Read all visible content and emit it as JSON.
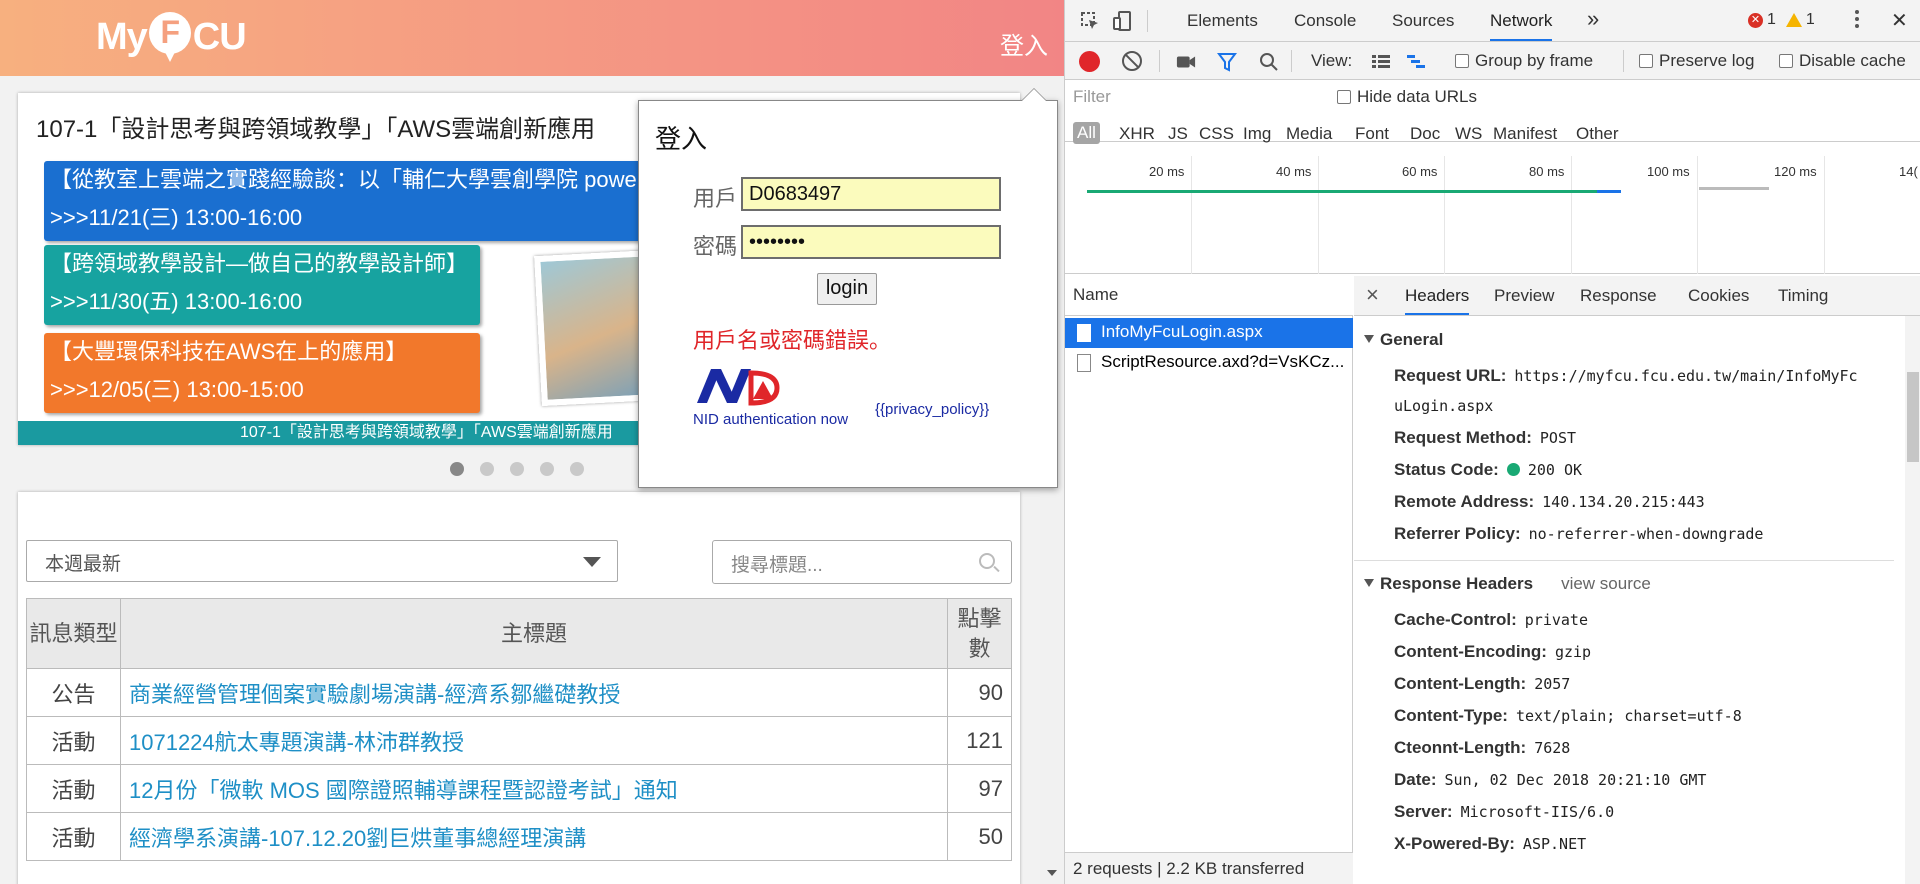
{
  "site": {
    "logo_text_left": "My",
    "logo_letter": "F",
    "logo_text_right": "CU",
    "login_link": "登入"
  },
  "banner": {
    "title": "107-1「設計思考與跨領域教學」「AWS雲端創新應用",
    "events": [
      {
        "line1": "【從教室上雲端之實踐經驗談：以「輔仁大學雲創學院 powe",
        "line2": ">>>11/21(三) 13:00-16:00",
        "color": "#1a6fd0"
      },
      {
        "line1": "【跨領域教學設計—做自己的教學設計師】",
        "line2": ">>>11/30(五) 13:00-16:00",
        "color": "#17a3a0"
      },
      {
        "line1": "【大豐環保科技在AWS在上的應用】",
        "line2": ">>>12/05(三) 13:00-15:00",
        "color": "#f2782b"
      }
    ],
    "strip_text": "107-1「設計思考與跨領域教學」「AWS雲端創新應用",
    "slide_count": 5,
    "active_slide": 1
  },
  "news": {
    "filter_value": "本週最新",
    "search_placeholder": "搜尋標題...",
    "headers": {
      "type": "訊息類型",
      "title": "主標題",
      "hits": "點擊數"
    },
    "rows": [
      {
        "type": "公告",
        "title": "商業經營管理個案實驗劇場演講-經濟系鄒繼礎教授",
        "hits": "90"
      },
      {
        "type": "活動",
        "title": "1071224航太專題演講-林沛群教授",
        "hits": "121"
      },
      {
        "type": "活動",
        "title": "12月份「微軟 MOS 國際證照輔導課程暨認證考試」通知",
        "hits": "97"
      },
      {
        "type": "活動",
        "title": "經濟學系演講-107.12.20劉巨烘董事總經理演講",
        "hits": "50"
      }
    ]
  },
  "login": {
    "heading": "登入",
    "user_label": "用戶",
    "user_value": "D0683497",
    "pass_label": "密碼",
    "pass_value": "••••••••",
    "button": "login",
    "error": "用戶名或密碼錯誤。",
    "nid_caption": "NID authentication now",
    "privacy_link": "{{privacy_policy}}"
  },
  "devtools": {
    "tabs": [
      "Elements",
      "Console",
      "Sources",
      "Network"
    ],
    "active_tab": "Network",
    "more": "»",
    "error_count": "1",
    "warning_count": "1",
    "close": "✕",
    "toolbar": {
      "view_label": "View:",
      "group_by_frame": "Group by frame",
      "preserve_log": "Preserve log",
      "disable_cache": "Disable cache"
    },
    "filter_placeholder": "Filter",
    "hide_data_urls": "Hide data URLs",
    "type_filters": [
      "All",
      "XHR",
      "JS",
      "CSS",
      "Img",
      "Media",
      "Font",
      "Doc",
      "WS",
      "Manifest",
      "Other"
    ],
    "timeline_ticks": [
      "20 ms",
      "40 ms",
      "60 ms",
      "80 ms",
      "100 ms",
      "120 ms",
      "14("
    ],
    "list_header": "Name",
    "requests": [
      "InfoMyFcuLogin.aspx",
      "ScriptResource.axd?d=VsKCz..."
    ],
    "status_bar": "2 requests  |  2.2 KB transferred",
    "detail_tabs": [
      "Headers",
      "Preview",
      "Response",
      "Cookies",
      "Timing"
    ],
    "general": {
      "title": "General",
      "request_url_key": "Request URL:",
      "request_url_line1": "https://myfcu.fcu.edu.tw/main/InfoMyFc",
      "request_url_line2": "uLogin.aspx",
      "method_key": "Request Method:",
      "method": "POST",
      "status_key": "Status Code:",
      "status": "200 OK",
      "remote_key": "Remote Address:",
      "remote": "140.134.20.215:443",
      "referrer_key": "Referrer Policy:",
      "referrer": "no-referrer-when-downgrade"
    },
    "response_headers": {
      "title": "Response Headers",
      "view_source": "view source",
      "items": [
        {
          "k": "Cache-Control:",
          "v": "private"
        },
        {
          "k": "Content-Encoding:",
          "v": "gzip"
        },
        {
          "k": "Content-Length:",
          "v": "2057"
        },
        {
          "k": "Content-Type:",
          "v": "text/plain; charset=utf-8"
        },
        {
          "k": "Cteonnt-Length:",
          "v": "7628"
        },
        {
          "k": "Date:",
          "v": "Sun, 02 Dec 2018 20:21:10 GMT"
        },
        {
          "k": "Server:",
          "v": "Microsoft-IIS/6.0"
        },
        {
          "k": "X-Powered-By:",
          "v": "ASP.NET"
        }
      ]
    }
  }
}
